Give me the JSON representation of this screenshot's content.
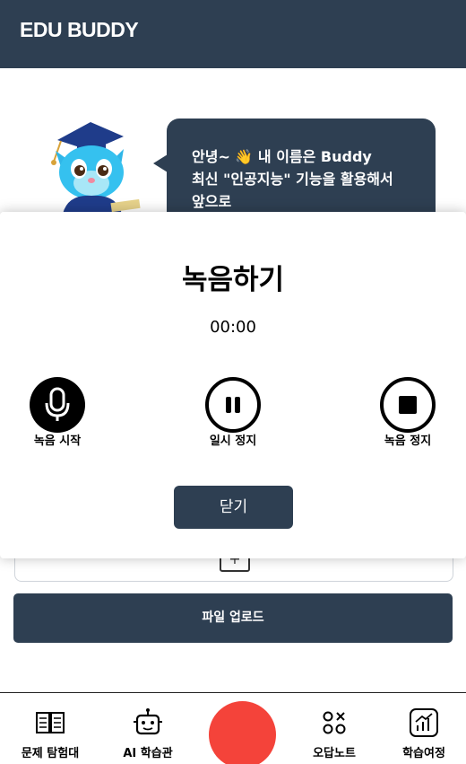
{
  "header": {
    "title": "EDU BUDDY"
  },
  "greeting": {
    "line1": "안녕~ 👋 내 이름은 Buddy",
    "line2": "최신 \"인공지능\" 기능을 활용해서",
    "line3": "앞으로"
  },
  "upload": {
    "button_label": "파일 업로드",
    "plus_symbol": "+"
  },
  "modal": {
    "title": "녹음하기",
    "timer": "00:00",
    "start_label": "녹음 시작",
    "pause_label": "일시 정지",
    "stop_label": "녹음 정지",
    "close_label": "닫기"
  },
  "bottom_nav": {
    "items": [
      {
        "label": "문제 탐험대",
        "icon": "book-icon"
      },
      {
        "label": "AI 학습관",
        "icon": "robot-icon"
      },
      {
        "label": "",
        "icon": "record-fab"
      },
      {
        "label": "오답노트",
        "icon": "circles-x-icon"
      },
      {
        "label": "학습여정",
        "icon": "growth-chart-icon"
      }
    ]
  },
  "colors": {
    "primary": "#2e3f52",
    "record": "#f4433a",
    "white": "#ffffff"
  }
}
